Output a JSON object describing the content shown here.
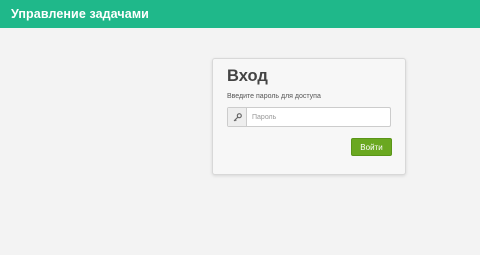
{
  "header": {
    "title": "Управление задачами",
    "background_color": "#1fb88a"
  },
  "login": {
    "title": "Вход",
    "hint": "Введите пароль для доступа",
    "password_placeholder": "Пароль",
    "password_value": "",
    "key_icon": "key-icon",
    "submit_label": "Войти",
    "submit_color": "#6aa820"
  }
}
